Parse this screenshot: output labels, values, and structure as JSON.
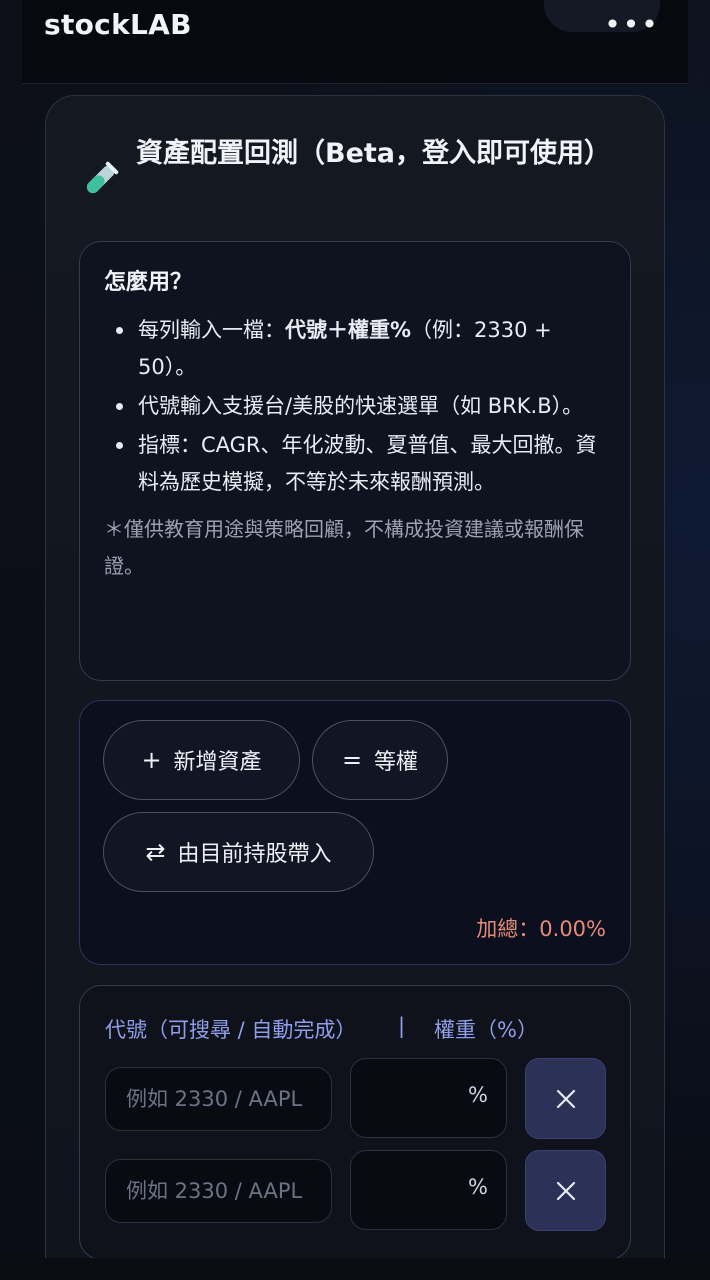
{
  "app": {
    "brand": "stockLAB",
    "more_icon": "more-dots-icon"
  },
  "panel": {
    "icon": "test-tube-icon",
    "title": "資產配置回測（Beta，登入即可使用）"
  },
  "howto": {
    "heading": "怎麼用？",
    "items": [
      {
        "pre": "每列輸入一檔：",
        "bold": "代號＋權重%",
        "post": "（例：2330 + 50）。"
      },
      {
        "text": "代號輸入支援台/美股的快速選單（如 BRK.B）。"
      },
      {
        "text": "指標：CAGR、年化波動、夏普值、最大回撤。資料為歷史模擬，不等於未來報酬預測。"
      }
    ],
    "note": "＊僅供教育用途與策略回顧，不構成投資建議或報酬保證。"
  },
  "actions": {
    "add_label": "新增資產",
    "add_icon": "plus-icon",
    "equal_label": "等權",
    "equal_icon": "equals-icon",
    "import_label": "由目前持股帶入",
    "import_icon": "swap-arrows-icon",
    "sum_label": "加總：0.00%"
  },
  "assets": {
    "col_code": "代號（可搜尋 / 自動完成）",
    "sep": "|",
    "col_weight": "權重（%）",
    "rows": [
      {
        "code_placeholder": "例如 2330 / AAPL",
        "weight_value": "",
        "weight_unit": "%"
      },
      {
        "code_placeholder": "例如 2330 / AAPL",
        "weight_value": "",
        "weight_unit": "%"
      }
    ]
  },
  "colors": {
    "accent": "#8f9ee8",
    "sum_warning": "#e58b7b",
    "delete_bg": "#2b3157"
  }
}
